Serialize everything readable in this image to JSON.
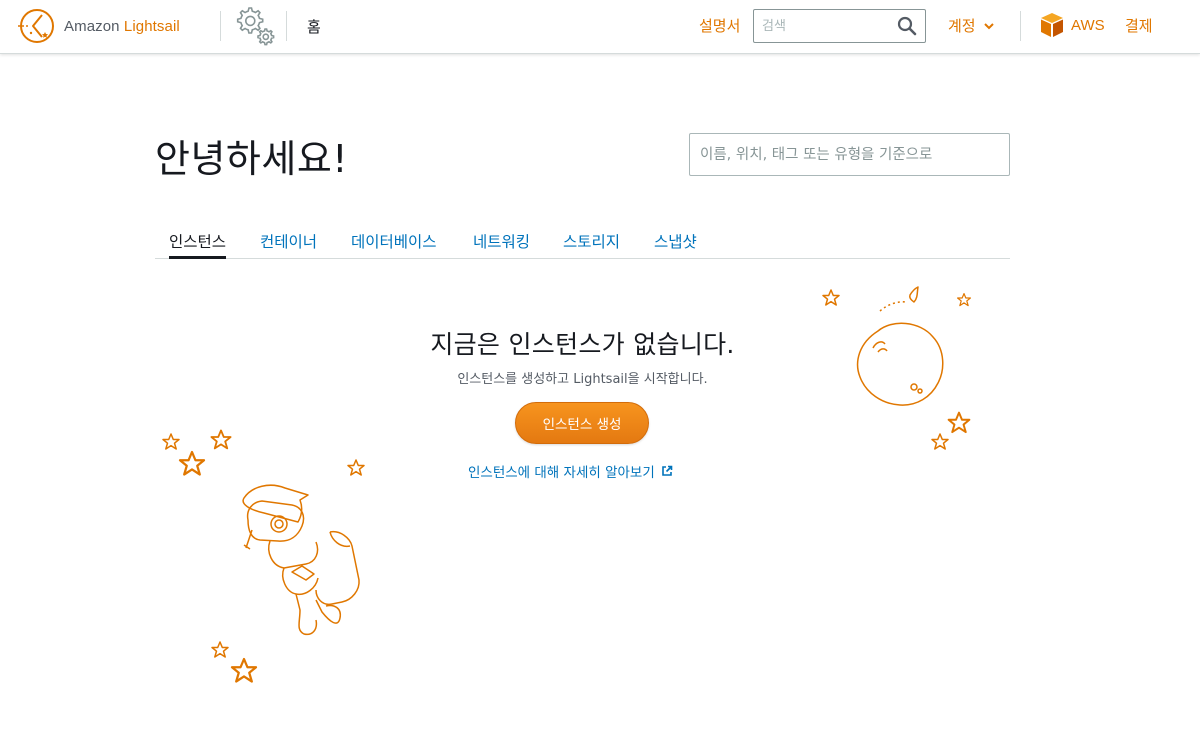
{
  "header": {
    "logo_prefix": "Amazon ",
    "logo_brand": "Lightsail",
    "home_label": "홈",
    "docs_label": "설명서",
    "search_placeholder": "검색",
    "account_label": "계정",
    "aws_label": "AWS",
    "billing_label": "결제"
  },
  "main": {
    "greeting": "안녕하세요!",
    "filter_placeholder": "이름, 위치, 태그 또는 유형을 기준으로",
    "tabs": [
      {
        "label": "인스턴스",
        "active": true
      },
      {
        "label": "컨테이너",
        "active": false
      },
      {
        "label": "데이터베이스",
        "active": false
      },
      {
        "label": "네트워킹",
        "active": false
      },
      {
        "label": "스토리지",
        "active": false
      },
      {
        "label": "스냅샷",
        "active": false
      }
    ],
    "empty_title": "지금은 인스턴스가 없습니다.",
    "empty_subtitle": "인스턴스를 생성하고 Lightsail을 시작합니다.",
    "create_button": "인스턴스 생성",
    "learn_link": "인스턴스에 대해 자세히 알아보기"
  },
  "colors": {
    "accent_orange": "#e07700",
    "link_blue": "#0073bb",
    "text_dark": "#16191f"
  },
  "icons": [
    "lightsail-logo-icon",
    "settings-gears-icon",
    "search-icon",
    "chevron-down-icon",
    "aws-box-icon",
    "external-link-icon"
  ]
}
